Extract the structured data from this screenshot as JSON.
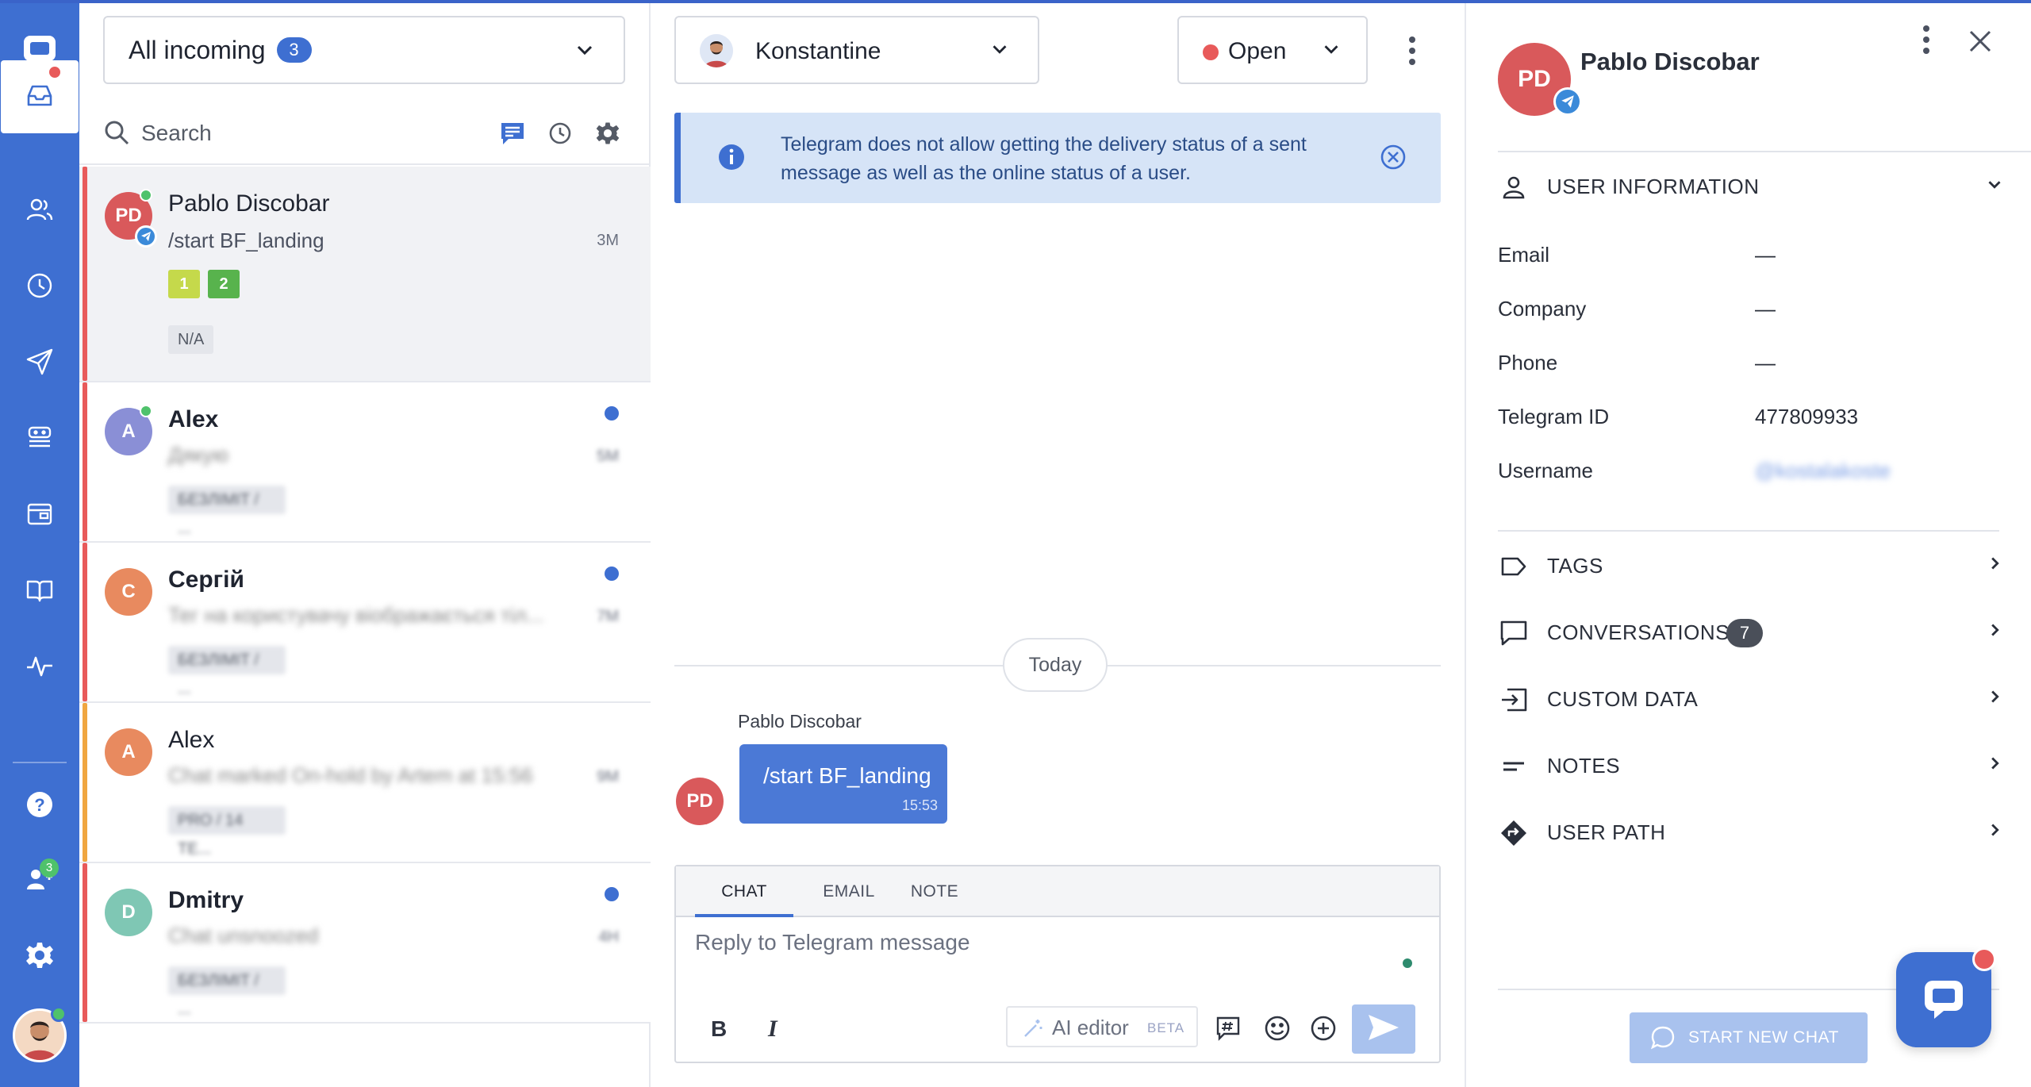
{
  "colors": {
    "accent": "#3e6fd1",
    "danger": "#e85a5a",
    "online": "#4fc26b",
    "telegram": "#3b8ad9"
  },
  "nav": {
    "items": [
      {
        "name": "inbox",
        "icon": "inbox-icon"
      },
      {
        "name": "contacts",
        "icon": "users-icon"
      },
      {
        "name": "history",
        "icon": "clock-icon"
      },
      {
        "name": "send",
        "icon": "paper-plane-icon"
      },
      {
        "name": "bots",
        "icon": "bot-icon"
      },
      {
        "name": "widgets",
        "icon": "window-icon"
      },
      {
        "name": "knowledge",
        "icon": "book-icon"
      },
      {
        "name": "analytics",
        "icon": "pulse-icon"
      },
      {
        "name": "help",
        "icon": "help-icon"
      },
      {
        "name": "team",
        "icon": "team-icon"
      },
      {
        "name": "settings",
        "icon": "gear-icon"
      }
    ],
    "team_badge": "3"
  },
  "list": {
    "filter_label": "All incoming",
    "filter_count": "3",
    "search_placeholder": "Search",
    "conversations": [
      {
        "name": "Pablo Discobar",
        "initials": "PD",
        "preview": "/start BF_landing",
        "time": "3M",
        "tags": [
          "1",
          "2"
        ],
        "label": "N/A",
        "avatar_color": "#d9595b",
        "strip_color": "#e85a5a"
      },
      {
        "name": "Alex",
        "initials": "A",
        "preview": "Дякую",
        "time": "5M",
        "label": "БЕЗЛІМІТ / ...",
        "avatar_color": "#8a8fd6",
        "strip_color": "#e85a5a"
      },
      {
        "name": "Сергій",
        "initials": "С",
        "preview": "Тег на користувачу вiображається тіл...",
        "time": "7M",
        "label": "БЕЗЛІМІТ / ...",
        "avatar_color": "#e88a5f",
        "strip_color": "#e85a5a"
      },
      {
        "name": "Alex",
        "initials": "A",
        "preview": "Chat marked On-hold by Artem at 15:56",
        "time": "9M",
        "label": "PRO / 14 TE...",
        "avatar_color": "#e88a5f",
        "strip_color": "#f0a640"
      },
      {
        "name": "Dmitry",
        "initials": "D",
        "preview": "Chat unsnoozed",
        "time": "4H",
        "label": "БЕЗЛІМІТ / ...",
        "avatar_color": "#7fc7b4",
        "strip_color": "#e85a5a"
      }
    ]
  },
  "chat": {
    "assignee": "Konstantine",
    "status": "Open",
    "banner": "Telegram does not allow getting the delivery status of a sent message as well as the online status of a user.",
    "day_label": "Today",
    "message": {
      "author": "Pablo Discobar",
      "author_initials": "PD",
      "text": "/start BF_landing",
      "time": "15:53"
    },
    "composer": {
      "tabs": [
        "CHAT",
        "EMAIL",
        "NOTE"
      ],
      "placeholder": "Reply to Telegram message",
      "ai_label": "AI editor",
      "ai_beta": "BETA"
    }
  },
  "profile": {
    "name": "Pablo Discobar",
    "initials": "PD",
    "user_info_title": "USER INFORMATION",
    "fields": [
      {
        "key": "Email",
        "value": "—"
      },
      {
        "key": "Company",
        "value": "—"
      },
      {
        "key": "Phone",
        "value": "—"
      },
      {
        "key": "Telegram ID",
        "value": "477809933"
      },
      {
        "key": "Username",
        "value": "@kostalakoste"
      }
    ],
    "sections": [
      {
        "label": "TAGS",
        "icon": "tag-icon"
      },
      {
        "label": "CONVERSATIONS",
        "icon": "chat-bubble-icon",
        "count": "7"
      },
      {
        "label": "CUSTOM DATA",
        "icon": "import-icon"
      },
      {
        "label": "NOTES",
        "icon": "notes-icon"
      },
      {
        "label": "USER PATH",
        "icon": "route-icon"
      }
    ],
    "start_chat_label": "START NEW CHAT"
  }
}
